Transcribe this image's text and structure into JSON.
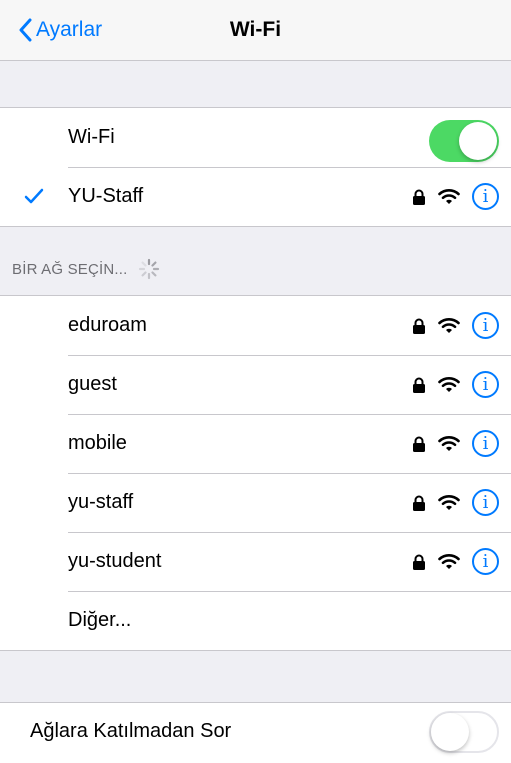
{
  "navbar": {
    "back_label": "Ayarlar",
    "title": "Wi-Fi"
  },
  "wifi_toggle": {
    "label": "Wi-Fi",
    "state": "on"
  },
  "connected": {
    "name": "YU-Staff",
    "secured": true
  },
  "section_header": "BİR AĞ SEÇİN...",
  "networks": [
    {
      "name": "eduroam",
      "secured": true
    },
    {
      "name": "guest",
      "secured": true
    },
    {
      "name": "mobile",
      "secured": true
    },
    {
      "name": "yu-staff",
      "secured": true
    },
    {
      "name": "yu-student",
      "secured": true
    }
  ],
  "other_label": "Diğer...",
  "ask_to_join": {
    "label": "Ağlara Katılmadan Sor",
    "state": "off"
  },
  "colors": {
    "accent": "#007aff",
    "toggle_on": "#4cd964",
    "background": "#efeff4"
  },
  "icons": [
    "chevron-left-icon",
    "checkmark-icon",
    "lock-icon",
    "wifi-icon",
    "info-icon",
    "spinner-icon"
  ]
}
